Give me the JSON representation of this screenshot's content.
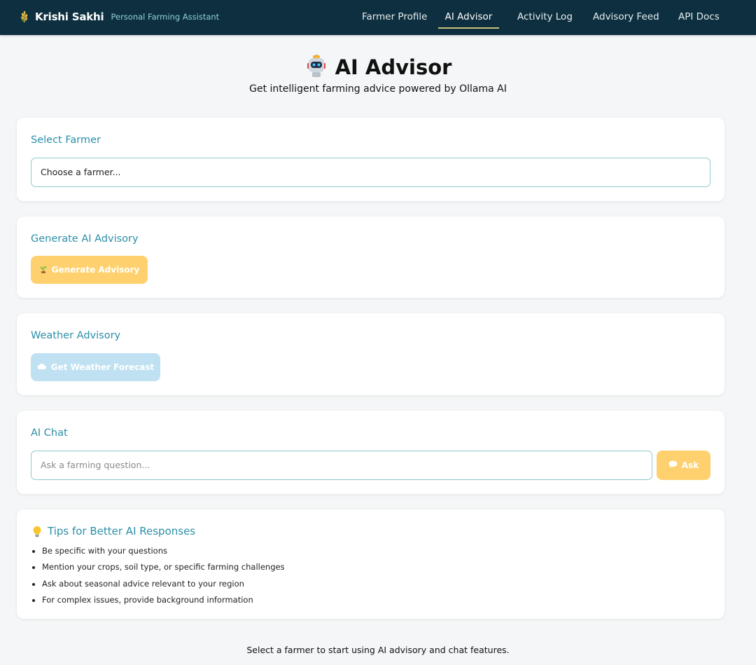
{
  "nav": {
    "brand_name": "Krishi Sakhi",
    "brand_tagline": "Personal Farming Assistant",
    "links": [
      {
        "label": "Farmer Profile",
        "active": false
      },
      {
        "label": "AI Advisor",
        "active": true
      },
      {
        "label": "Activity Log",
        "active": false
      },
      {
        "label": "Advisory Feed",
        "active": false
      },
      {
        "label": "API Docs",
        "active": false
      }
    ]
  },
  "hero": {
    "icon": "robot-icon",
    "title": "AI Advisor",
    "subtitle": "Get intelligent farming advice powered by Ollama AI"
  },
  "select_farmer": {
    "title": "Select Farmer",
    "selected_value": "Choose a farmer..."
  },
  "generate_advisory": {
    "title": "Generate AI Advisory",
    "button_label": "Generate Advisory",
    "button_icon": "seedling-icon"
  },
  "weather": {
    "title": "Weather Advisory",
    "button_label": "Get Weather Forecast",
    "button_icon": "cloud-icon"
  },
  "chat": {
    "title": "AI Chat",
    "placeholder": "Ask a farming question...",
    "ask_label": "Ask",
    "ask_icon": "speech-bubble-icon"
  },
  "tips": {
    "title": "Tips for Better AI Responses",
    "icon": "lightbulb-icon",
    "items": [
      "Be specific with your questions",
      "Mention your crops, soil type, or specific farming challenges",
      "Ask about seasonal advice relevant to your region",
      "For complex issues, provide background information"
    ]
  },
  "footer_note": "Select a farmer to start using AI advisory and chat features.",
  "colors": {
    "navbar_bg": "#0d2f3f",
    "accent_teal": "#2b8fa8",
    "button_yellow": "#fed16e",
    "button_blue_disabled": "#bfe1f2",
    "page_bg": "#f4f6f7"
  }
}
